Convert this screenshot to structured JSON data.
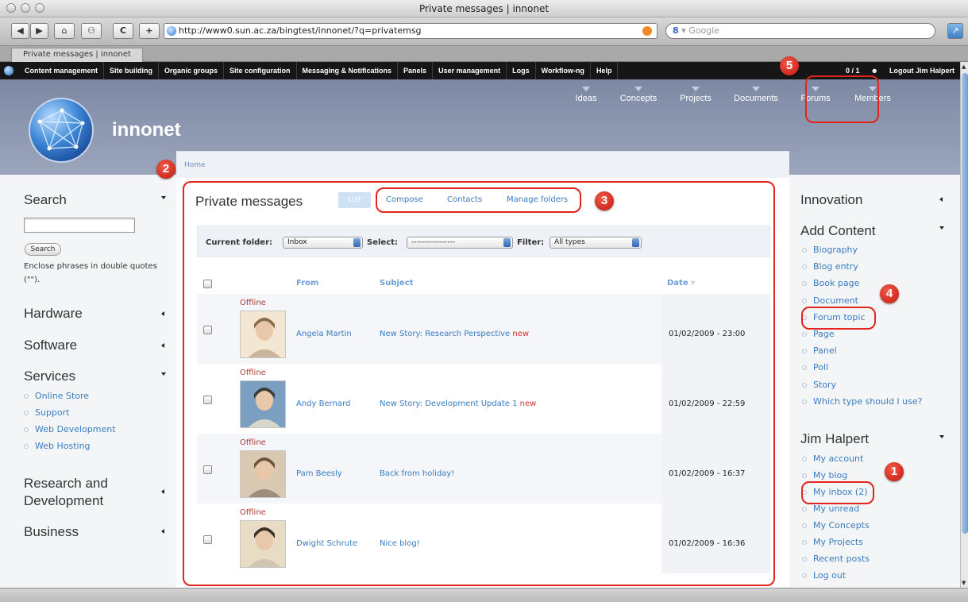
{
  "window": {
    "title": "Private messages | innonet"
  },
  "toolbar": {
    "back": "◀",
    "forward": "▶",
    "home": "⌂",
    "bookmark": "⚇",
    "reload": "C",
    "add": "+",
    "url": "http://www0.sun.ac.za/bingtest/innonet/?q=privatemsg",
    "search_engine_letter": "8",
    "search_placeholder": "Google"
  },
  "tab": {
    "label": "Private messages | innonet"
  },
  "admin_menu": {
    "items": [
      "Content management",
      "Site building",
      "Organic groups",
      "Site configuration",
      "Messaging & Notifications",
      "Panels",
      "User management",
      "Logs",
      "Workflow-ng",
      "Help"
    ],
    "counter": "0 / 1",
    "logout": "Logout Jim Halpert"
  },
  "header": {
    "site_name": "innonet",
    "primary_links": [
      "Ideas",
      "Concepts",
      "Projects",
      "Documents",
      "Forums",
      "Members"
    ]
  },
  "breadcrumb": {
    "home": "Home"
  },
  "left_sidebar": {
    "search": {
      "title": "Search",
      "button": "Search",
      "hint": "Enclose phrases in double quotes (\"\")."
    },
    "hardware": "Hardware",
    "software": "Software",
    "services": {
      "title": "Services",
      "items": [
        "Online Store",
        "Support",
        "Web Development",
        "Web Hosting"
      ]
    },
    "research": {
      "line1": "Research and",
      "line2": "Development"
    },
    "business": "Business"
  },
  "main": {
    "title": "Private messages",
    "tabs": {
      "list": "List",
      "compose": "Compose",
      "contacts": "Contacts",
      "manage": "Manage folders"
    },
    "filters": {
      "folder_label": "Current folder:",
      "folder_value": "Inbox",
      "select_label": "Select:",
      "select_value": "-----------------",
      "filter_label": "Filter:",
      "filter_value": "All types"
    },
    "columns": {
      "from": "From",
      "subject": "Subject",
      "date": "Date"
    },
    "messages": [
      {
        "status": "Offline",
        "from": "Angela Martin",
        "subject": "New Story: Research Perspective",
        "new": "new",
        "date": "01/02/2009 - 23:00"
      },
      {
        "status": "Offline",
        "from": "Andy Bernard",
        "subject": "New Story: Development Update 1",
        "new": "new",
        "date": "01/02/2009 - 22:59"
      },
      {
        "status": "Offline",
        "from": "Pam Beesly",
        "subject": "Back from holiday!",
        "new": "",
        "date": "01/02/2009 - 16:37"
      },
      {
        "status": "Offline",
        "from": "Dwight Schrute",
        "subject": "Nice blog!",
        "new": "",
        "date": "01/02/2009 - 16:36"
      }
    ]
  },
  "right_sidebar": {
    "innovation": "Innovation",
    "add_content": {
      "title": "Add Content",
      "items": [
        "Biography",
        "Blog entry",
        "Book page",
        "Document",
        "Forum topic",
        "Page",
        "Panel",
        "Poll",
        "Story",
        "Which type should I use?"
      ]
    },
    "user": {
      "title": "Jim Halpert",
      "items": [
        "My account",
        "My blog",
        "My inbox (2)",
        "My unread",
        "My Concepts",
        "My Projects",
        "Recent posts",
        "Log out"
      ]
    }
  },
  "annotations": {
    "b1": "1",
    "b2": "2",
    "b3": "3",
    "b4": "4",
    "b5": "5"
  },
  "colors": {
    "accent_red": "#e2241c",
    "link_blue": "#3a7cc0",
    "header_blue": "#8591ab"
  }
}
